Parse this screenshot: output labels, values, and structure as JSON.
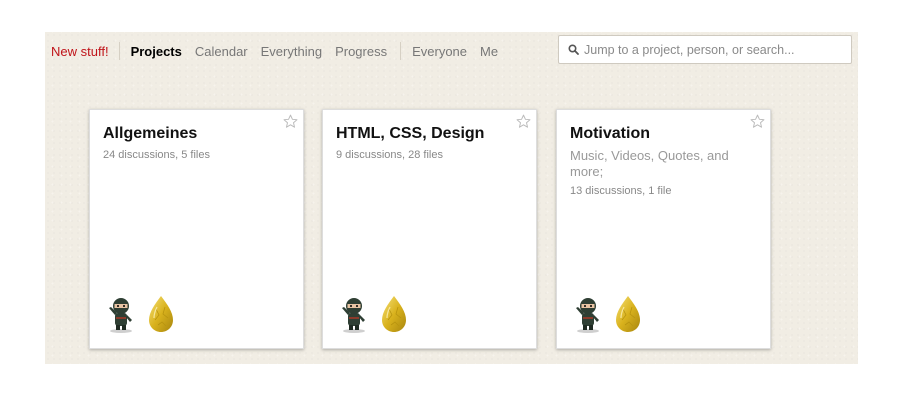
{
  "nav": {
    "new_stuff": "New stuff!",
    "projects": "Projects",
    "calendar": "Calendar",
    "everything": "Everything",
    "progress": "Progress",
    "everyone": "Everyone",
    "me": "Me"
  },
  "search": {
    "placeholder": "Jump to a project, person, or search..."
  },
  "projects": [
    {
      "title": "Allgemeines",
      "description": "",
      "meta": "24 discussions, 5 files"
    },
    {
      "title": "HTML, CSS, Design",
      "description": "",
      "meta": "9 discussions, 28 files"
    },
    {
      "title": "Motivation",
      "description": "Music, Videos, Quotes, and more;",
      "meta": "13 discussions, 1 file"
    }
  ],
  "icons": {
    "star": "star-outline-icon",
    "search": "search-icon",
    "avatar_1": "ninja-avatar",
    "avatar_2": "gold-egg-avatar"
  },
  "colors": {
    "accent_new": "#c0141a",
    "background": "#f1ede4"
  }
}
